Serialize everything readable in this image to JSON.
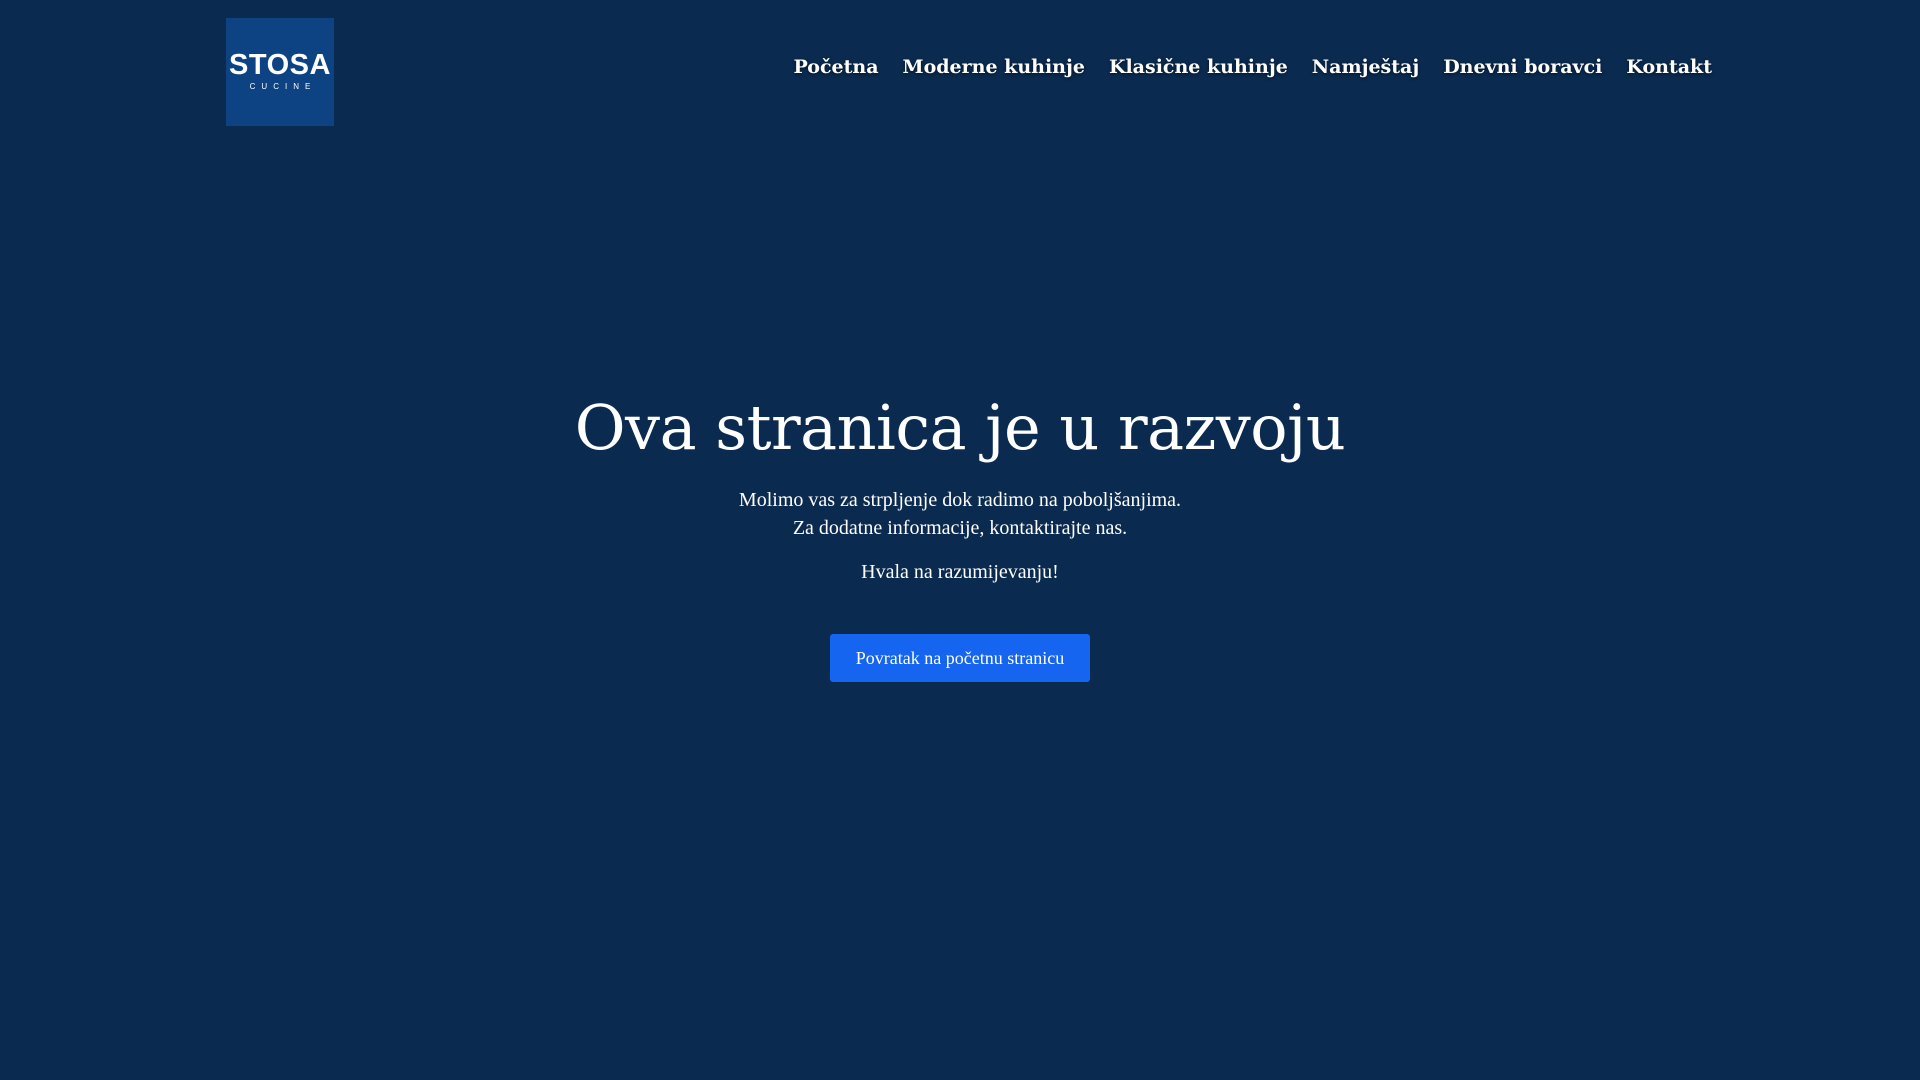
{
  "header": {
    "logo": {
      "main": "STOSA",
      "sub": "CUCINE"
    },
    "nav": [
      {
        "label": "Početna"
      },
      {
        "label": "Moderne kuhinje"
      },
      {
        "label": "Klasične kuhinje"
      },
      {
        "label": "Namještaj"
      },
      {
        "label": "Dnevni boravci"
      },
      {
        "label": "Kontakt"
      }
    ]
  },
  "main": {
    "title": "Ova stranica je u razvoju",
    "line1": "Molimo vas za strpljenje dok radimo na poboljšanjima.",
    "line2": "Za dodatne informacije, kontaktirajte nas.",
    "thanks": "Hvala na razumijevanju!",
    "button_label": "Povratak na početnu stranicu"
  },
  "colors": {
    "background": "#0a2a4f",
    "logo_bg": "#0d4383",
    "button": "#1565f0",
    "text": "#ffffff"
  }
}
